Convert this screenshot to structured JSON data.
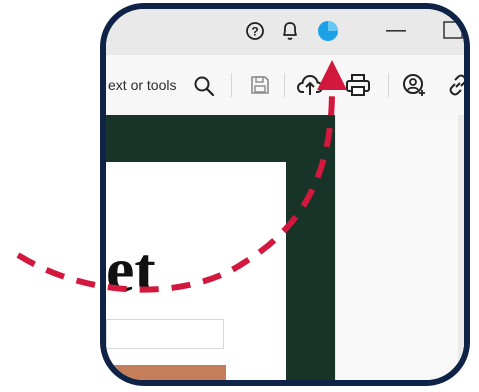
{
  "window": {
    "help_icon": "question-circle-icon",
    "notifications_icon": "bell-icon",
    "account_icon": "avatar-icon",
    "minimize_icon": "minimize-icon"
  },
  "toolbar": {
    "search_text": "ext or tools",
    "search_icon": "search-icon",
    "save_icon": "save-icon",
    "upload_icon": "cloud-upload-icon",
    "print_icon": "print-icon",
    "share_user_icon": "add-user-icon",
    "link_icon": "link-icon"
  },
  "document": {
    "heading_fragment": "et",
    "background_color": "#183328",
    "accent_color": "#c47e5a"
  },
  "annotation": {
    "color": "#d3183e",
    "frame_color": "#0f2346"
  }
}
